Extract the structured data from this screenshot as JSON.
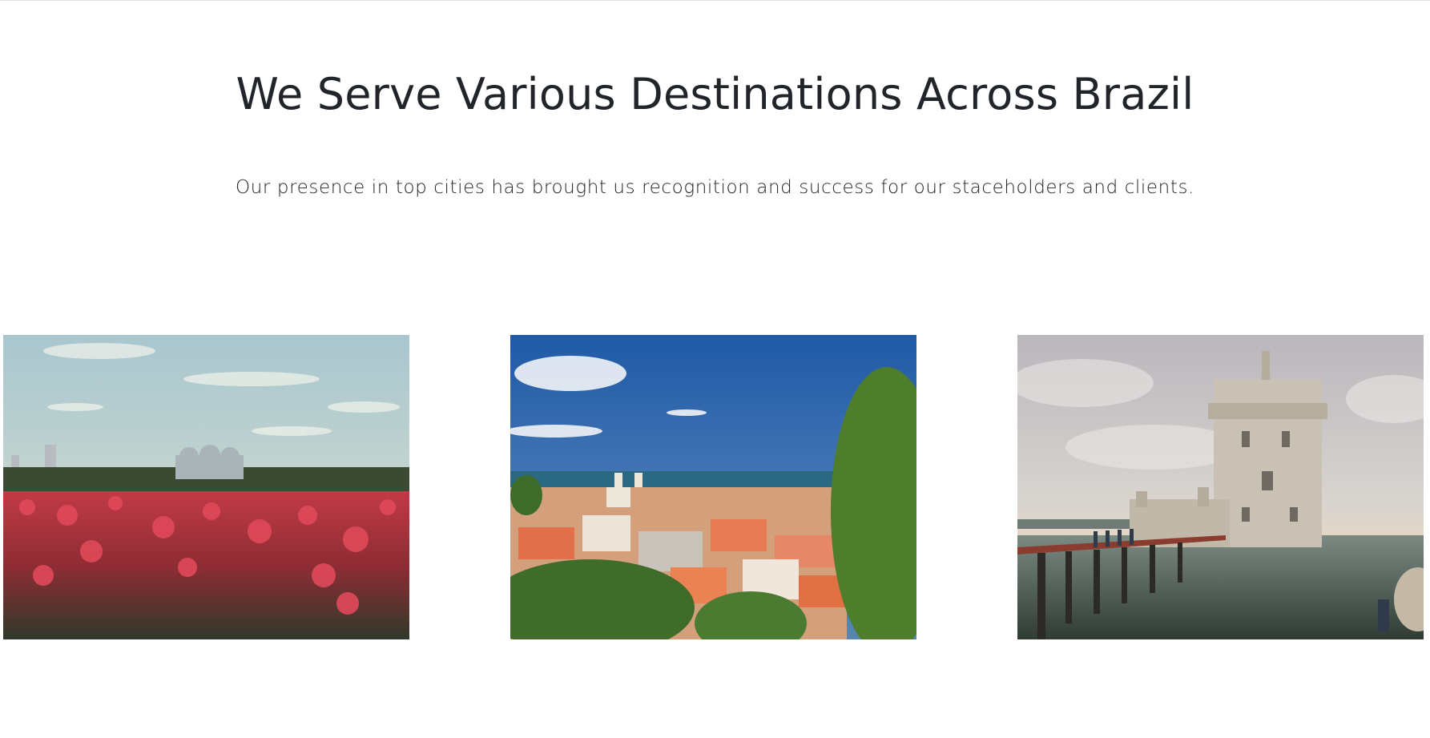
{
  "section": {
    "title": "We Serve Various Destinations Across Brazil",
    "subtitle": "Our presence in top cities has brought us recognition and success for our staceholders and clients."
  },
  "destinations": [
    {
      "image": "flower-garden-greenhouse-photo"
    },
    {
      "image": "coastal-city-rooftops-photo"
    },
    {
      "image": "waterfront-tower-bridge-photo"
    }
  ]
}
